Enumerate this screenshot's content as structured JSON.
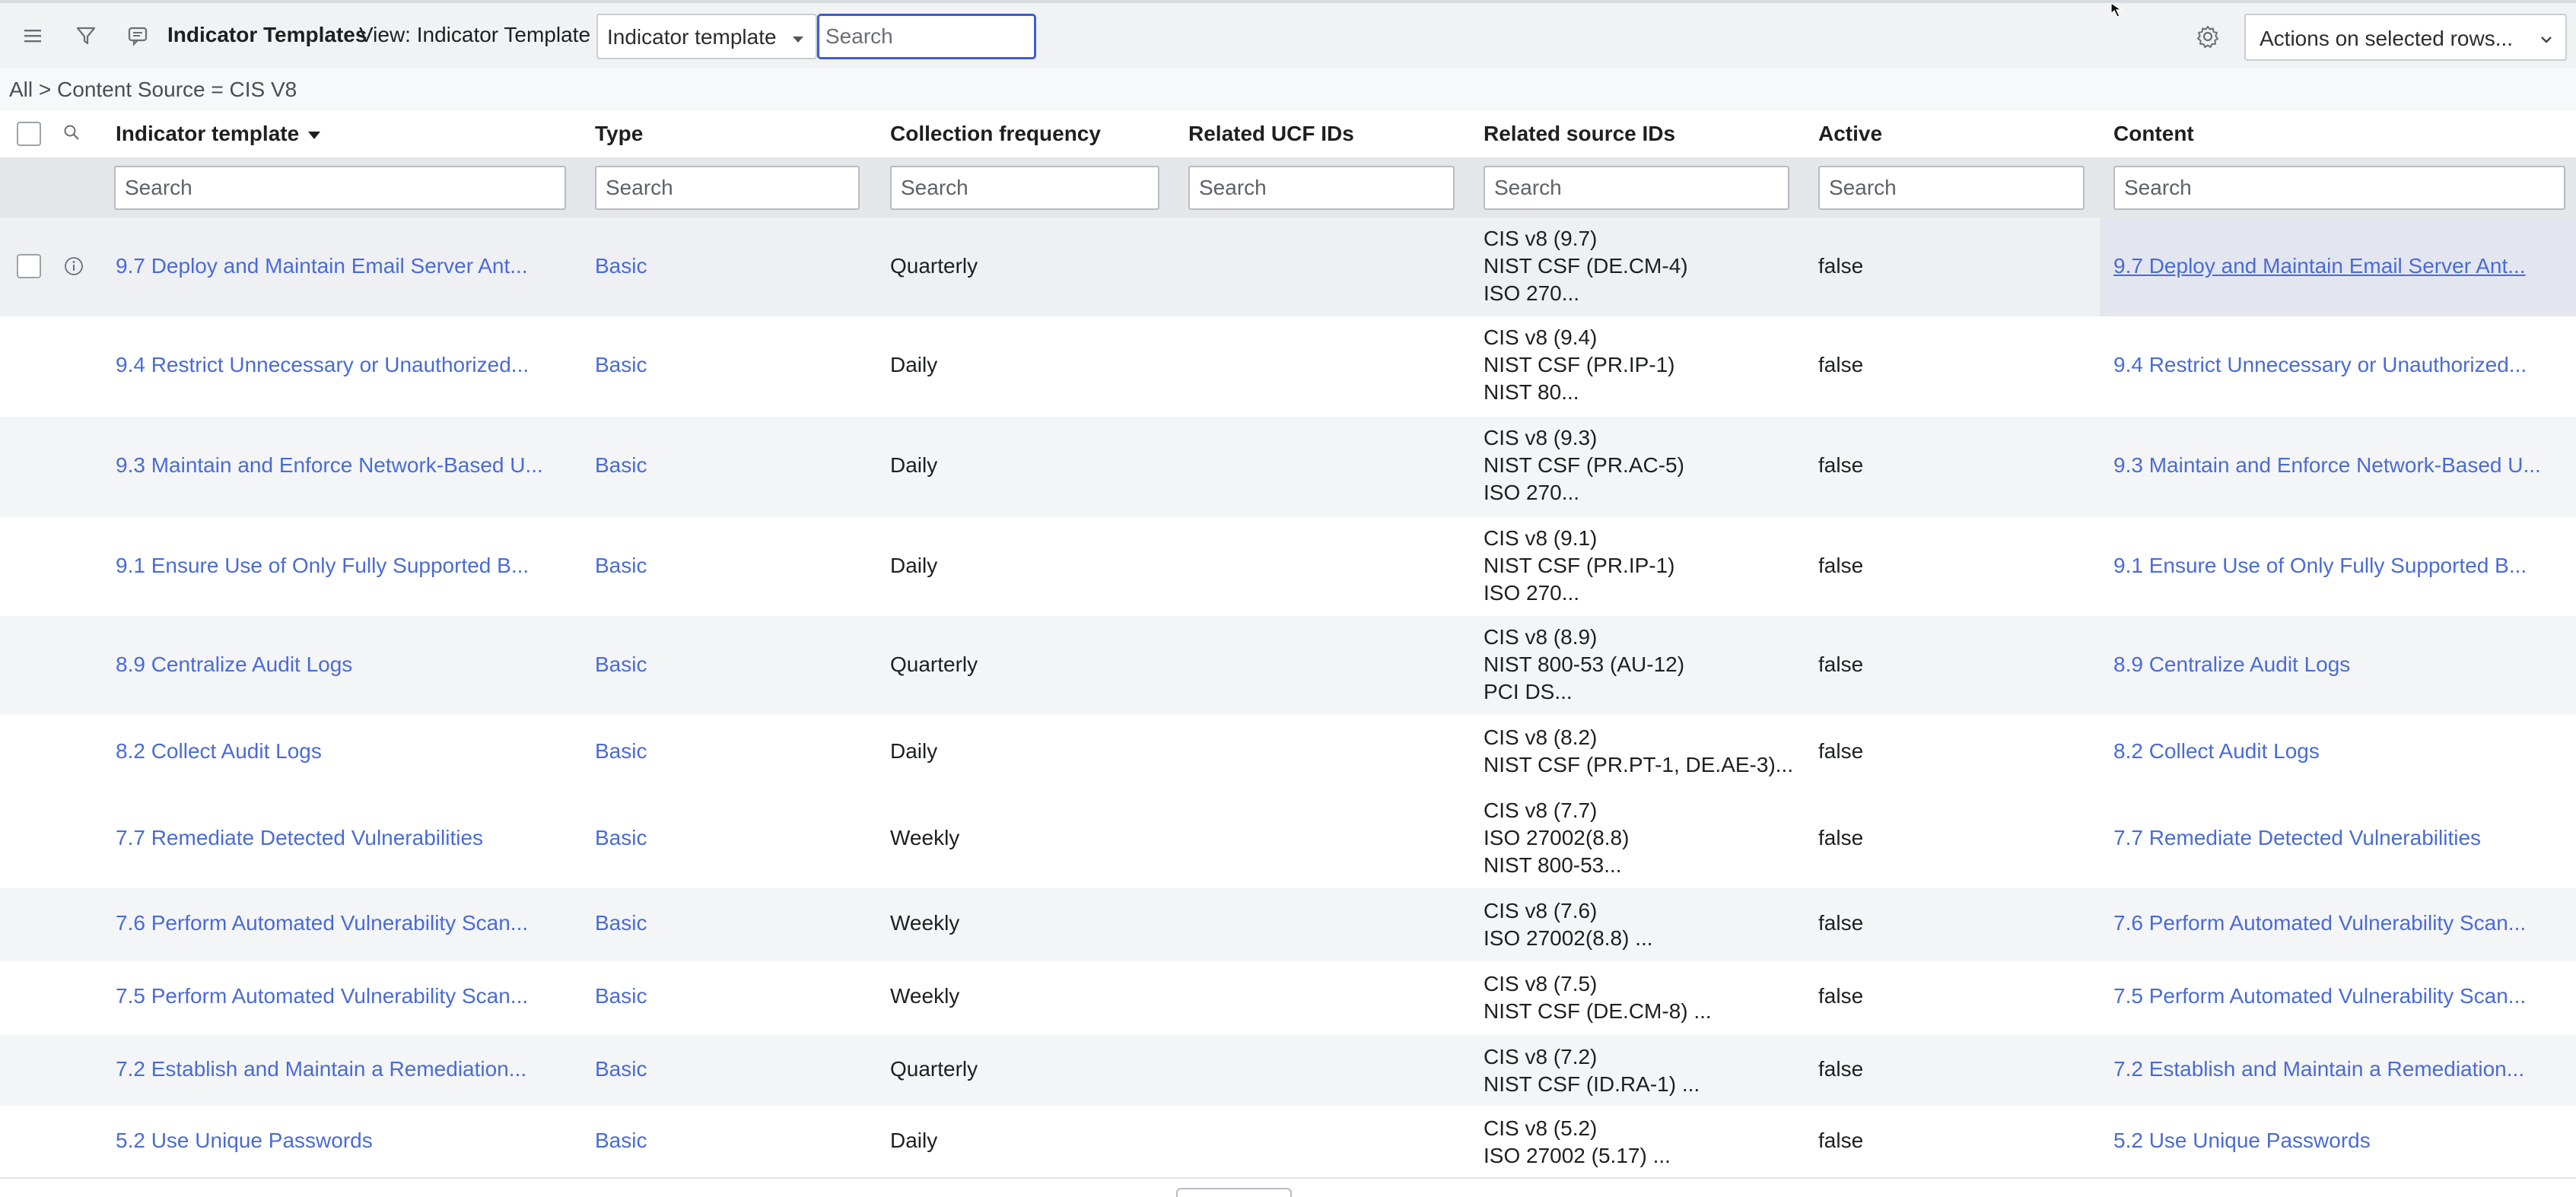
{
  "header": {
    "title": "Indicator Templates",
    "view_label": "View: Indicator Template",
    "field_select_value": "Indicator template",
    "search_placeholder": "Search",
    "actions_label": "Actions on selected rows..."
  },
  "breadcrumb": "All > Content Source = CIS V8",
  "columns": {
    "indicator_template": "Indicator template",
    "type": "Type",
    "collection_frequency": "Collection frequency",
    "related_ucf_ids": "Related UCF IDs",
    "related_source_ids": "Related source IDs",
    "active": "Active",
    "content": "Content"
  },
  "filter_placeholder": "Search",
  "rows": [
    {
      "name": "9.7 Deploy and Maintain Email Server Ant...",
      "type": "Basic",
      "freq": "Quarterly",
      "src": [
        "CIS v8 (9.7)",
        "NIST CSF (DE.CM-4)",
        "ISO 270..."
      ],
      "active": "false",
      "content": "9.7 Deploy and Maintain Email Server Ant..."
    },
    {
      "name": "9.4 Restrict Unnecessary or Unauthorized...",
      "type": "Basic",
      "freq": "Daily",
      "src": [
        "CIS v8 (9.4)",
        "NIST CSF (PR.IP-1)",
        "NIST 80..."
      ],
      "active": "false",
      "content": "9.4 Restrict Unnecessary or Unauthorized..."
    },
    {
      "name": "9.3 Maintain and Enforce Network-Based U...",
      "type": "Basic",
      "freq": "Daily",
      "src": [
        "CIS v8 (9.3)",
        "NIST CSF (PR.AC-5)",
        "ISO 270..."
      ],
      "active": "false",
      "content": "9.3 Maintain and Enforce Network-Based U..."
    },
    {
      "name": "9.1 Ensure Use of Only Fully Supported B...",
      "type": "Basic",
      "freq": "Daily",
      "src": [
        "CIS v8 (9.1)",
        "NIST CSF (PR.IP-1)",
        "ISO 270..."
      ],
      "active": "false",
      "content": "9.1 Ensure Use of Only Fully Supported B..."
    },
    {
      "name": "8.9 Centralize Audit Logs",
      "type": "Basic",
      "freq": "Quarterly",
      "src": [
        "CIS v8 (8.9)",
        "NIST 800-53 (AU-12)",
        "PCI DS..."
      ],
      "active": "false",
      "content": "8.9 Centralize Audit Logs"
    },
    {
      "name": "8.2 Collect Audit Logs",
      "type": "Basic",
      "freq": "Daily",
      "src": [
        "CIS v8 (8.2)",
        "NIST CSF (PR.PT-1, DE.AE-3)..."
      ],
      "active": "false",
      "content": "8.2 Collect Audit Logs"
    },
    {
      "name": "7.7 Remediate Detected Vulnerabilities",
      "type": "Basic",
      "freq": "Weekly",
      "src": [
        "CIS v8 (7.7)",
        "ISO 27002(8.8)",
        "NIST 800-53..."
      ],
      "active": "false",
      "content": "7.7 Remediate Detected Vulnerabilities"
    },
    {
      "name": "7.6 Perform Automated Vulnerability Scan...",
      "type": "Basic",
      "freq": "Weekly",
      "src": [
        "CIS v8 (7.6)",
        "ISO 27002(8.8) ..."
      ],
      "active": "false",
      "content": "7.6 Perform Automated Vulnerability Scan..."
    },
    {
      "name": "7.5 Perform Automated Vulnerability Scan...",
      "type": "Basic",
      "freq": "Weekly",
      "src": [
        "CIS v8 (7.5)",
        "NIST CSF (DE.CM-8) ..."
      ],
      "active": "false",
      "content": "7.5 Perform Automated Vulnerability Scan..."
    },
    {
      "name": "7.2 Establish and Maintain a Remediation...",
      "type": "Basic",
      "freq": "Quarterly",
      "src": [
        "CIS v8 (7.2)",
        "NIST CSF (ID.RA-1) ..."
      ],
      "active": "false",
      "content": "7.2 Establish and Maintain a Remediation..."
    },
    {
      "name": "5.2 Use Unique Passwords",
      "type": "Basic",
      "freq": "Daily",
      "src": [
        "CIS v8 (5.2)",
        "ISO 27002 (5.17) ..."
      ],
      "active": "false",
      "content": "5.2 Use Unique Passwords"
    }
  ]
}
